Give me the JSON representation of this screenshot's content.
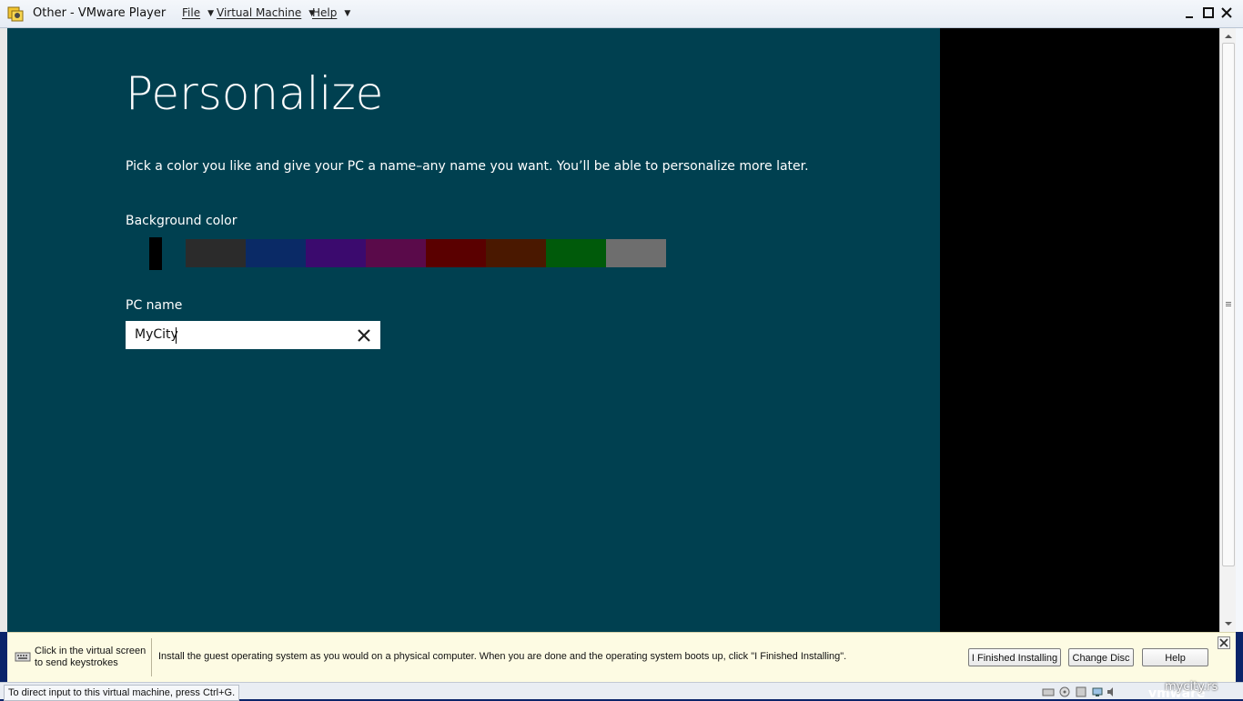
{
  "window": {
    "title": "Other - VMware Player",
    "menus": [
      {
        "label": "File"
      },
      {
        "label": "Virtual Machine"
      },
      {
        "label": "Help"
      }
    ],
    "icons": {
      "app": "vmware-player-icon",
      "minimize": "minimize-icon",
      "maximize": "maximize-icon",
      "close": "close-icon"
    }
  },
  "guest": {
    "heading": "Personalize",
    "description": "Pick a color you like and give your PC a name–any name you want. You’ll be able to personalize more later.",
    "background_label": "Background color",
    "swatches": [
      {
        "color": "#004050",
        "selected": true
      },
      {
        "color": "#2b2b2b"
      },
      {
        "color": "#0a2a66"
      },
      {
        "color": "#3b0a6e"
      },
      {
        "color": "#5a0a4a"
      },
      {
        "color": "#5a0000"
      },
      {
        "color": "#4a1800"
      },
      {
        "color": "#005a0a"
      },
      {
        "color": "#6e6e6e"
      }
    ],
    "pc_name_label": "PC name",
    "pc_name_value": "MyCity",
    "clear_icon": "close-icon"
  },
  "infobar": {
    "left_text_line1": "Click in the virtual screen",
    "left_text_line2": "to send keystrokes",
    "message": "Install the guest operating system as you would on a physical computer. When you are done and the operating system boots up, click \"I Finished Installing\".",
    "buttons": {
      "finished": "I Finished Installing",
      "change_disc": "Change Disc",
      "help": "Help"
    }
  },
  "statusbar": {
    "text": "To direct input to this virtual machine, press Ctrl+G.",
    "brand": "vmware"
  },
  "watermark": "mycity.rs"
}
